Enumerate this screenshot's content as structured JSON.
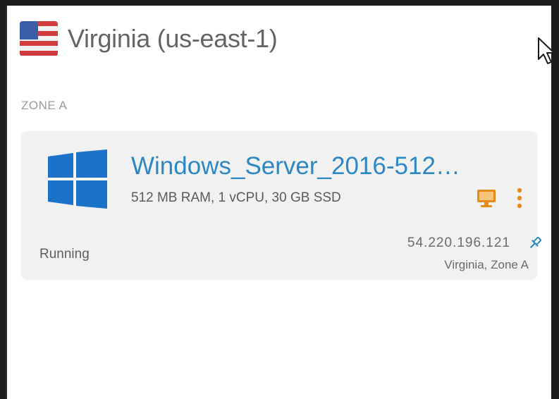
{
  "region": {
    "title": "Virginia (us-east-1)",
    "flag_icon": "us-flag-icon"
  },
  "zone": {
    "label": "ZONE A"
  },
  "instance": {
    "name": "Windows_Server_2016-512…",
    "specs": "512 MB RAM, 1 vCPU, 30 GB SSD",
    "status": "Running",
    "ip_address": "54.220.196.121",
    "location": "Virginia, Zone A",
    "os_icon": "windows-logo-icon"
  },
  "actions": {
    "connect_icon": "monitor-icon",
    "menu_icon": "more-vertical-icon",
    "pin_icon": "pin-icon"
  },
  "colors": {
    "accent_blue": "#2c87c5",
    "action_orange": "#e88a18",
    "windows_blue": "#1a73c8",
    "card_bg": "#f1f1f1"
  }
}
